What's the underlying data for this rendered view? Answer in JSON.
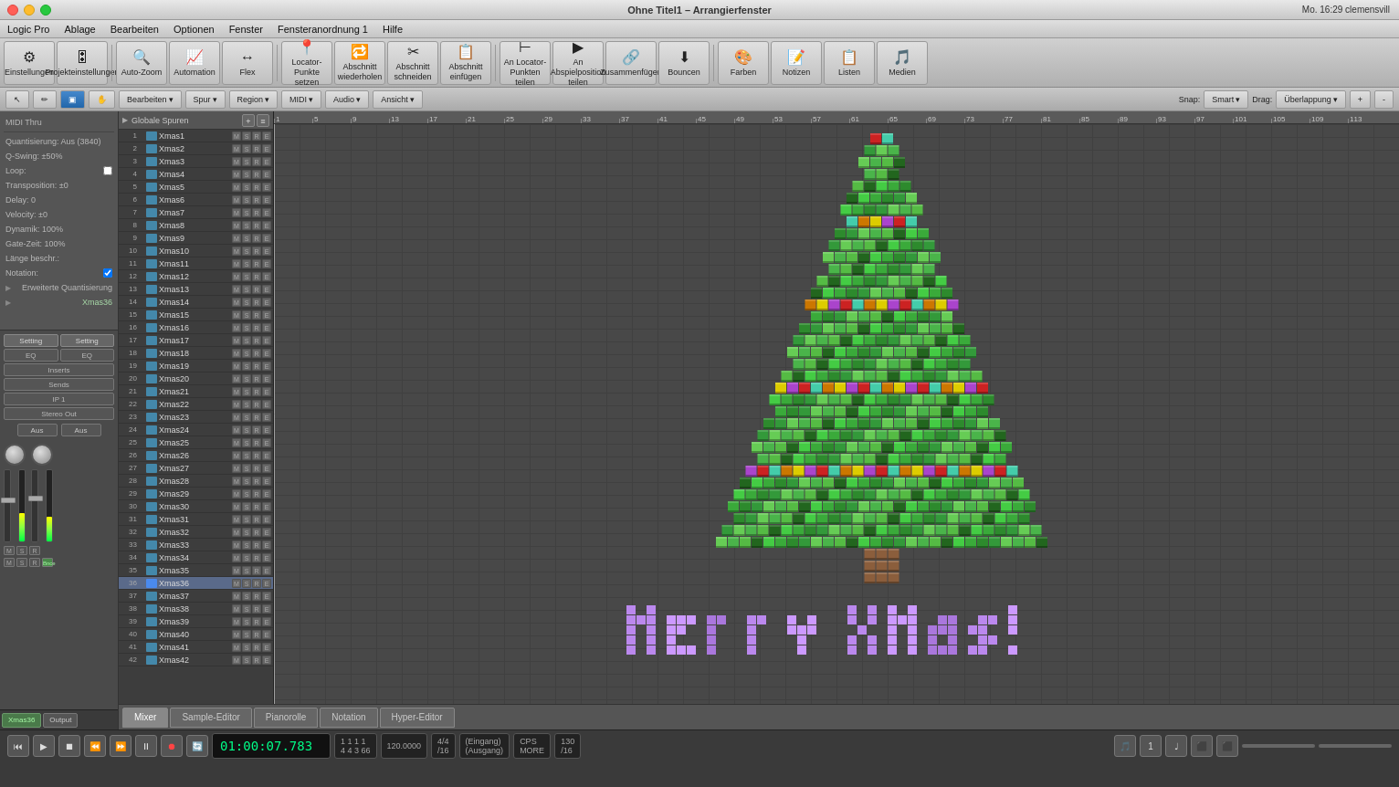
{
  "app": {
    "title": "Logic Pro",
    "window_title": "Ohne Titel1 – Arrangierfenster"
  },
  "titlebar": {
    "title": "Ohne Titel1 – Arrangierfenster",
    "right_info": "Mo. 16:29  clemensvill"
  },
  "menubar": {
    "items": [
      "Logic Pro",
      "Ablage",
      "Bearbeiten",
      "Optionen",
      "Fenster",
      "Fensteranordnung 1",
      "Hilfe"
    ]
  },
  "toolbar": {
    "buttons": [
      {
        "id": "einstellungen",
        "label": "Einstellungen",
        "icon": "⚙"
      },
      {
        "id": "projekteinstellungen",
        "label": "Projekteinstellungen",
        "icon": "🎛"
      },
      {
        "id": "auto-zoom",
        "label": "Auto-Zoom",
        "icon": "🔍"
      },
      {
        "id": "automation",
        "label": "Automation",
        "icon": "📈"
      },
      {
        "id": "flex",
        "label": "Flex",
        "icon": "↔"
      },
      {
        "id": "locator-punkte",
        "label": "Locator-Punkte setzen",
        "icon": "📍"
      },
      {
        "id": "abschnitt-wiederholen",
        "label": "Abschnitt wiederholen",
        "icon": "🔁"
      },
      {
        "id": "abschnitt-schneiden",
        "label": "Abschnitt schneiden",
        "icon": "✂"
      },
      {
        "id": "abschnitt-einfuegen",
        "label": "Abschnitt einfügen",
        "icon": "📋"
      },
      {
        "id": "locator-teilen",
        "label": "An Locator-Punkten teilen",
        "icon": "⊢"
      },
      {
        "id": "abspielposition",
        "label": "An Abspielposition teilen",
        "icon": "▶⊢"
      },
      {
        "id": "zusammenfuegen",
        "label": "Zusammenfügen",
        "icon": "🔗"
      },
      {
        "id": "bouncen",
        "label": "Bouncen",
        "icon": "⬇"
      },
      {
        "id": "farben",
        "label": "Farben",
        "icon": "🎨"
      },
      {
        "id": "notizen",
        "label": "Notizen",
        "icon": "📝"
      },
      {
        "id": "listen",
        "label": "Listen",
        "icon": "📋"
      },
      {
        "id": "medien",
        "label": "Medien",
        "icon": "🎵"
      }
    ]
  },
  "toolbar2": {
    "bearbeiten": "Bearbeiten",
    "spur": "Spur",
    "region": "Region",
    "midi": "MIDI",
    "audio": "Audio",
    "ansicht": "Ansicht",
    "snap_label": "Snap:",
    "snap_value": "Smart",
    "drag_label": "Drag:",
    "drag_value": "Überlappung"
  },
  "left_panel": {
    "midi_thru": "MIDI Thru",
    "quantisierung": "Quantisierung: Aus (3840)",
    "q_swing": "Q-Swing: ±50%",
    "loop": "Loop:",
    "transposition": "Transposition: ±0",
    "delay": "Delay: 0",
    "velocity": "Velocity: ±0",
    "dynamik": "Dynamik: 100%",
    "gate_zeit": "Gate-Zeit: 100%",
    "laenge_beschr": "Länge beschr.:",
    "notation": "Notation:",
    "erweiterte_quantisierung": "Erweiterte Quantisierung",
    "xmas36": "Xmas36",
    "setting1": "Setting",
    "setting2": "Setting",
    "eq1": "EQ",
    "eq2": "EQ",
    "inserts": "Inserts",
    "sends": "Sends",
    "io": "IP 1",
    "stereo_out": "Stereo Out",
    "aus1": "Aus",
    "aus2": "Aus",
    "xmas36_tab": "Xmas36",
    "output_tab": "Output"
  },
  "tracks": [
    {
      "num": "1",
      "name": "Xmas1",
      "selected": false
    },
    {
      "num": "2",
      "name": "Xmas2",
      "selected": false
    },
    {
      "num": "3",
      "name": "Xmas3",
      "selected": false
    },
    {
      "num": "4",
      "name": "Xmas4",
      "selected": false
    },
    {
      "num": "5",
      "name": "Xmas5",
      "selected": false
    },
    {
      "num": "6",
      "name": "Xmas6",
      "selected": false
    },
    {
      "num": "7",
      "name": "Xmas7",
      "selected": false
    },
    {
      "num": "8",
      "name": "Xmas8",
      "selected": false
    },
    {
      "num": "9",
      "name": "Xmas9",
      "selected": false
    },
    {
      "num": "10",
      "name": "Xmas10",
      "selected": false
    },
    {
      "num": "11",
      "name": "Xmas11",
      "selected": false
    },
    {
      "num": "12",
      "name": "Xmas12",
      "selected": false
    },
    {
      "num": "13",
      "name": "Xmas13",
      "selected": false
    },
    {
      "num": "14",
      "name": "Xmas14",
      "selected": false
    },
    {
      "num": "15",
      "name": "Xmas15",
      "selected": false
    },
    {
      "num": "16",
      "name": "Xmas16",
      "selected": false
    },
    {
      "num": "17",
      "name": "Xmas17",
      "selected": false
    },
    {
      "num": "18",
      "name": "Xmas18",
      "selected": false
    },
    {
      "num": "19",
      "name": "Xmas19",
      "selected": false
    },
    {
      "num": "20",
      "name": "Xmas20",
      "selected": false
    },
    {
      "num": "21",
      "name": "Xmas21",
      "selected": false
    },
    {
      "num": "22",
      "name": "Xmas22",
      "selected": false
    },
    {
      "num": "23",
      "name": "Xmas23",
      "selected": false
    },
    {
      "num": "24",
      "name": "Xmas24",
      "selected": false
    },
    {
      "num": "25",
      "name": "Xmas25",
      "selected": false
    },
    {
      "num": "26",
      "name": "Xmas26",
      "selected": false
    },
    {
      "num": "27",
      "name": "Xmas27",
      "selected": false
    },
    {
      "num": "28",
      "name": "Xmas28",
      "selected": false
    },
    {
      "num": "29",
      "name": "Xmas29",
      "selected": false
    },
    {
      "num": "30",
      "name": "Xmas30",
      "selected": false
    },
    {
      "num": "31",
      "name": "Xmas31",
      "selected": false
    },
    {
      "num": "32",
      "name": "Xmas32",
      "selected": false
    },
    {
      "num": "33",
      "name": "Xmas33",
      "selected": false
    },
    {
      "num": "34",
      "name": "Xmas34",
      "selected": false
    },
    {
      "num": "35",
      "name": "Xmas35",
      "selected": false
    },
    {
      "num": "36",
      "name": "Xmas36",
      "selected": true
    },
    {
      "num": "37",
      "name": "Xmas37",
      "selected": false
    },
    {
      "num": "38",
      "name": "Xmas38",
      "selected": false
    },
    {
      "num": "39",
      "name": "Xmas39",
      "selected": false
    },
    {
      "num": "40",
      "name": "Xmas40",
      "selected": false
    },
    {
      "num": "41",
      "name": "Xmas41",
      "selected": false
    },
    {
      "num": "42",
      "name": "Xmas42",
      "selected": false
    }
  ],
  "transport": {
    "time_display": "01:00:07.783",
    "bar_beat": "1  1  1  1",
    "tempo": "120.0000",
    "time_sig": "4/4",
    "eingang": "(Eingang)",
    "ausgang": "(Ausgang)",
    "bpm_label": "130",
    "sub": "/16"
  },
  "bottom_tabs": [
    {
      "id": "mixer",
      "label": "Mixer"
    },
    {
      "id": "sample-editor",
      "label": "Sample-Editor"
    },
    {
      "id": "pianorolle",
      "label": "Pianorolle"
    },
    {
      "id": "notation",
      "label": "Notation"
    },
    {
      "id": "hyper-editor",
      "label": "Hyper-Editor"
    }
  ],
  "colors": {
    "green_dark": "#2d7a2d",
    "green_bright": "#4dc44d",
    "green_light": "#88dd88",
    "red": "#cc2222",
    "yellow": "#ddcc00",
    "cyan": "#44ccaa",
    "orange": "#cc7700",
    "purple": "#aa77cc",
    "purple_text": "#bb88ee",
    "brown": "#996633",
    "accent_blue": "#4488aa",
    "selected_blue": "#5a6a8a"
  }
}
